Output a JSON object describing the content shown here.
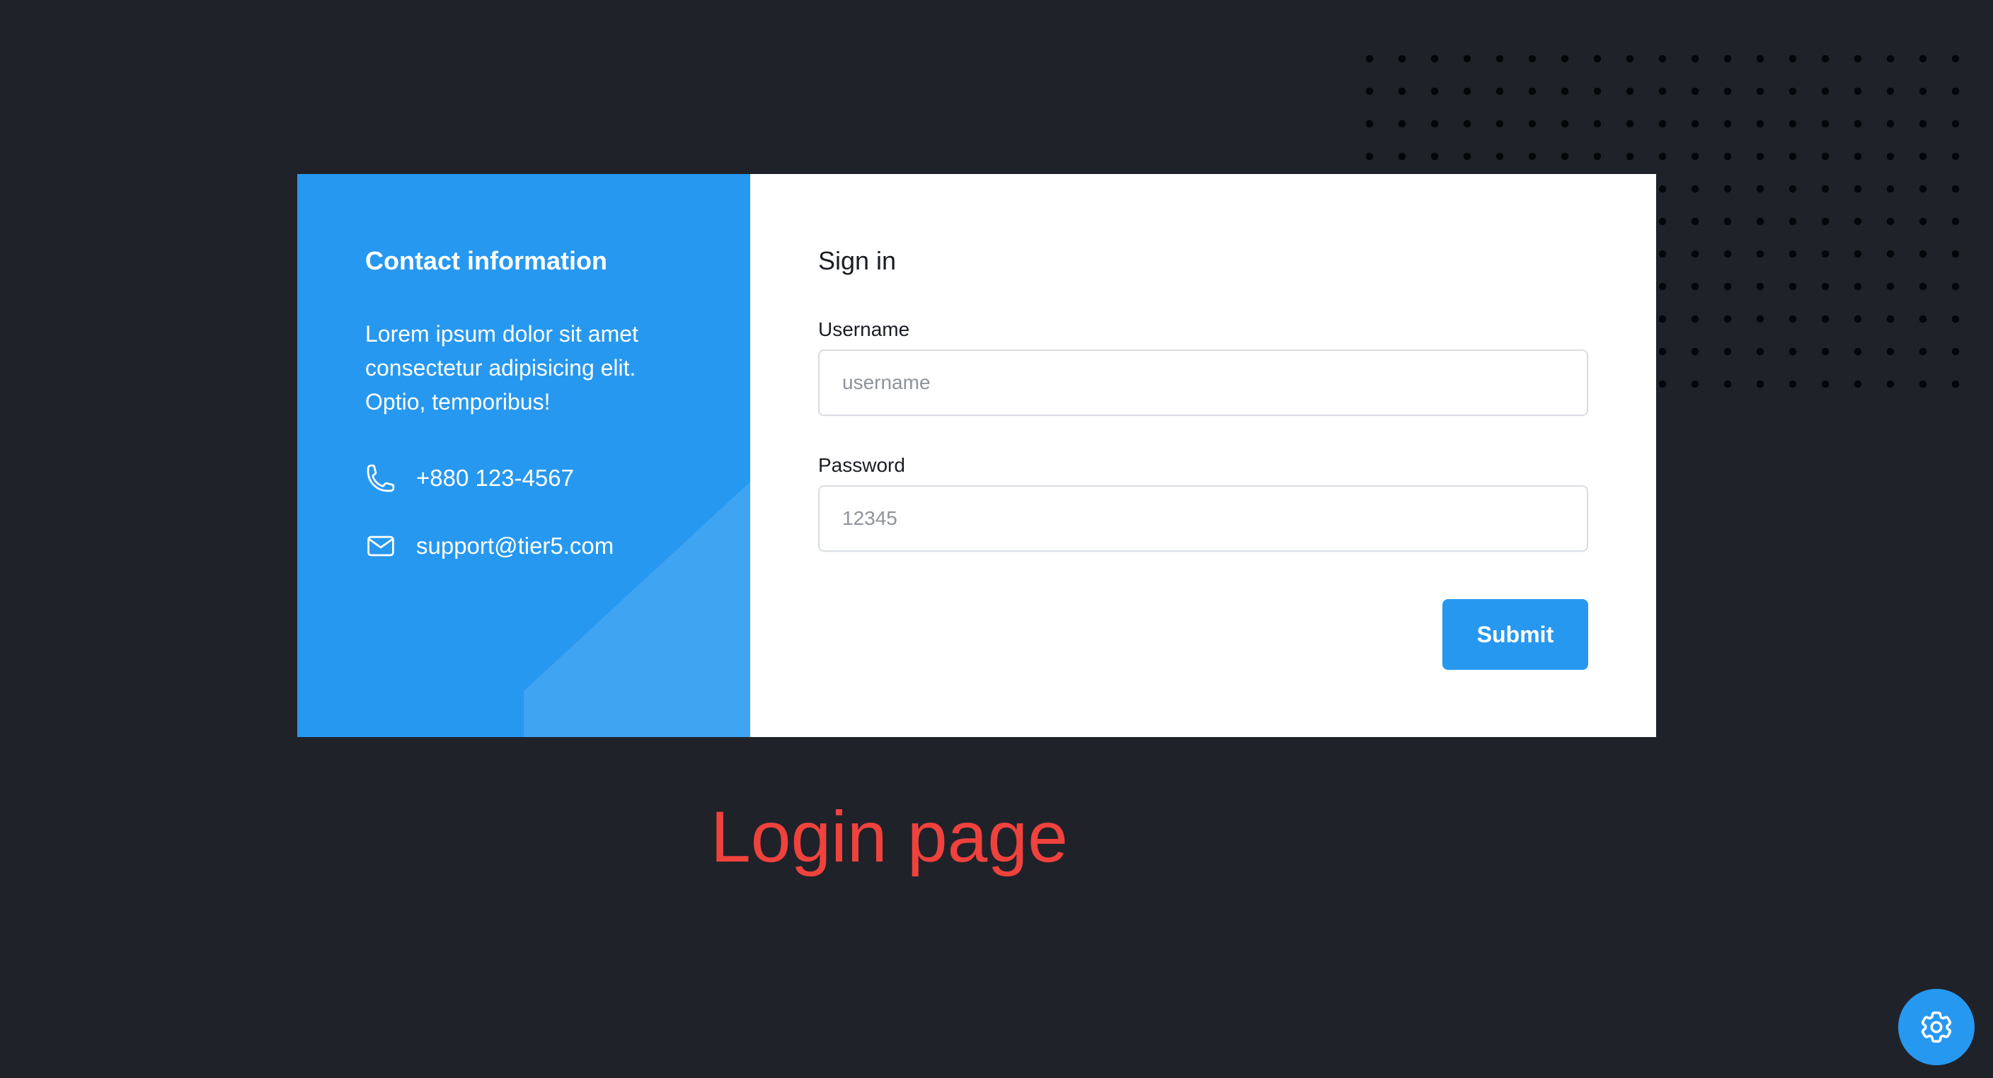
{
  "contact": {
    "title": "Contact information",
    "description": "Lorem ipsum dolor sit amet consectetur adipisicing elit. Optio, temporibus!",
    "phone": "+880 123-4567",
    "email": "support@tier5.com",
    "phone_icon": "phone-icon",
    "email_icon": "mail-icon"
  },
  "form": {
    "title": "Sign in",
    "username_label": "Username",
    "username_placeholder": "username",
    "username_value": "",
    "password_label": "Password",
    "password_placeholder": "12345",
    "password_value": "",
    "submit_label": "Submit"
  },
  "caption": "Login page",
  "settings": {
    "icon": "gear-icon"
  },
  "colors": {
    "background": "#20222a",
    "accent": "#2798f0",
    "accent_shape": "#3fa4f2",
    "caption": "#f0423d",
    "card": "#ffffff"
  }
}
